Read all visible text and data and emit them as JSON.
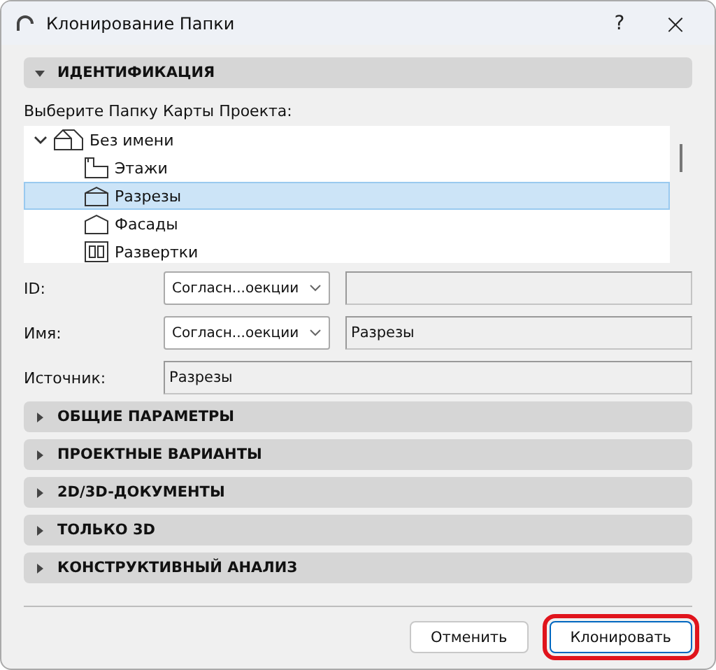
{
  "window": {
    "title": "Клонирование Папки",
    "help": "?",
    "close": "×"
  },
  "identification": {
    "title": "ИДЕНТИФИКАЦИЯ",
    "expanded": true,
    "tree_label": "Выберите Папку Карты Проекта:",
    "tree": [
      {
        "label": "Без имени",
        "kind": "project",
        "expanded": true,
        "selected": false,
        "children": [
          {
            "label": "Этажи",
            "kind": "stories",
            "selected": false
          },
          {
            "label": "Разрезы",
            "kind": "section",
            "selected": true
          },
          {
            "label": "Фасады",
            "kind": "elevation",
            "selected": false
          },
          {
            "label": "Развертки",
            "kind": "interior",
            "selected": false
          }
        ]
      }
    ],
    "fields": [
      {
        "label": "ID:",
        "kind": "combo",
        "dropdown": "Согласн...оекции"
      },
      {
        "label": "Имя:",
        "kind": "combo",
        "dropdown": "Согласн...оекции",
        "value": "Разрезы"
      },
      {
        "label": "Источник:",
        "kind": "text",
        "value": "Разрезы"
      }
    ]
  },
  "sections": [
    {
      "title": "ОБЩИЕ ПАРАМЕТРЫ",
      "expanded": false
    },
    {
      "title": "ПРОЕКТНЫЕ ВАРИАНТЫ",
      "expanded": false
    },
    {
      "title": "2D/3D-ДОКУМЕНТЫ",
      "expanded": false
    },
    {
      "title": "ТОЛЬКО 3D",
      "expanded": false
    },
    {
      "title": "КОНСТРУКТИВНЫЙ АНАЛИЗ",
      "expanded": false
    }
  ],
  "buttons": [
    {
      "label": "Отменить",
      "highlighted": false
    },
    {
      "label": "Клонировать",
      "highlighted": true
    }
  ]
}
